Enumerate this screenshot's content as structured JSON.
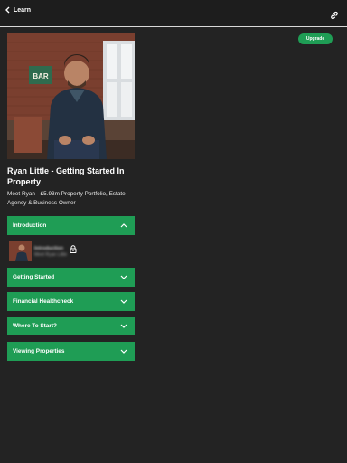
{
  "header": {
    "back_label": "Learn"
  },
  "upgrade_label": "Upgrade",
  "hero": {
    "sign_text": "BAR"
  },
  "course": {
    "title": "Ryan Little - Getting Started In Property",
    "subtitle": "Meet Ryan - £5.93m Property Portfolio, Estate Agency & Business Owner"
  },
  "sections": [
    {
      "label": "Introduction",
      "expanded": true
    },
    {
      "label": "Getting Started",
      "expanded": false
    },
    {
      "label": "Financial Healthcheck",
      "expanded": false
    },
    {
      "label": "Where To Start?",
      "expanded": false
    },
    {
      "label": "Viewing Properties",
      "expanded": false
    }
  ],
  "lesson": {
    "title": "Introduction",
    "subtitle": "Meet Ryan Little",
    "locked": true
  },
  "colors": {
    "accent": "#1f9d55",
    "background": "#232323",
    "topbar": "#1d1d1d"
  }
}
